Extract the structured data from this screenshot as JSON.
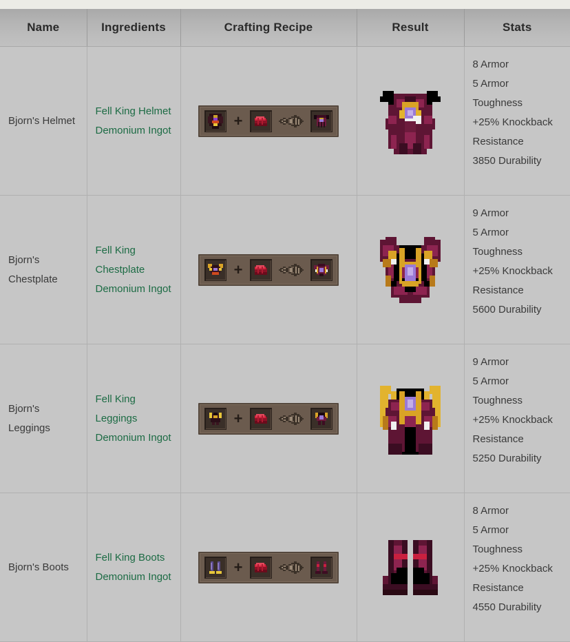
{
  "table": {
    "columns": [
      {
        "key": "name",
        "label": "Name"
      },
      {
        "key": "ingredients",
        "label": "Ingredients"
      },
      {
        "key": "recipe",
        "label": "Crafting Recipe"
      },
      {
        "key": "result",
        "label": "Result"
      },
      {
        "key": "stats",
        "label": "Stats"
      }
    ],
    "rows": [
      {
        "name": "Bjorn's Helmet",
        "ingredients": [
          "Fell King Helmet",
          "Demonium Ingot"
        ],
        "recipe": {
          "input_item": "fell-king-helmet-icon",
          "plus": "+",
          "material_item": "demonium-ingot-icon",
          "arrow": "smithing-arrow-icon",
          "output_item": "bjorns-helmet-icon"
        },
        "result_art": "bjorns-helmet-art",
        "stats": [
          "8 Armor",
          "5 Armor",
          "Toughness",
          "+25% Knockback",
          "Resistance",
          "3850 Durability"
        ]
      },
      {
        "name": "Bjorn's Chestplate",
        "ingredients": [
          "Fell King Chestplate",
          "Demonium Ingot"
        ],
        "recipe": {
          "input_item": "fell-king-chestplate-icon",
          "plus": "+",
          "material_item": "demonium-ingot-icon",
          "arrow": "smithing-arrow-icon",
          "output_item": "bjorns-chestplate-icon"
        },
        "result_art": "bjorns-chestplate-art",
        "stats": [
          "9 Armor",
          "5 Armor",
          "Toughness",
          "+25% Knockback",
          "Resistance",
          "5600 Durability"
        ]
      },
      {
        "name": "Bjorn's Leggings",
        "ingredients": [
          "Fell King Leggings",
          "Demonium Ingot"
        ],
        "recipe": {
          "input_item": "fell-king-leggings-icon",
          "plus": "+",
          "material_item": "demonium-ingot-icon",
          "arrow": "smithing-arrow-icon",
          "output_item": "bjorns-leggings-icon"
        },
        "result_art": "bjorns-leggings-art",
        "stats": [
          "9 Armor",
          "5 Armor",
          "Toughness",
          "+25% Knockback",
          "Resistance",
          "5250 Durability"
        ]
      },
      {
        "name": "Bjorn's Boots",
        "ingredients": [
          "Fell King Boots",
          "Demonium Ingot"
        ],
        "recipe": {
          "input_item": "fell-king-boots-icon",
          "plus": "+",
          "material_item": "demonium-ingot-icon",
          "arrow": "smithing-arrow-icon",
          "output_item": "bjorns-boots-icon"
        },
        "result_art": "bjorns-boots-art",
        "stats": [
          "8 Armor",
          "5 Armor",
          "Toughness",
          "+25% Knockback",
          "Resistance",
          "4550 Durability"
        ]
      }
    ]
  },
  "colors": {
    "link_green": "#1c6b44",
    "header_gray": "#b4b4b4",
    "cell_gray": "#c6c6c6",
    "page_bg": "#ecece6",
    "text_dark": "#3a3a3a",
    "armor_maroon": "#6d1b3d",
    "armor_dark": "#2a0d1a",
    "gem_purple": "#9a7ad8",
    "trim_gold": "#e8b81e",
    "ingot_red": "#c9203f"
  }
}
